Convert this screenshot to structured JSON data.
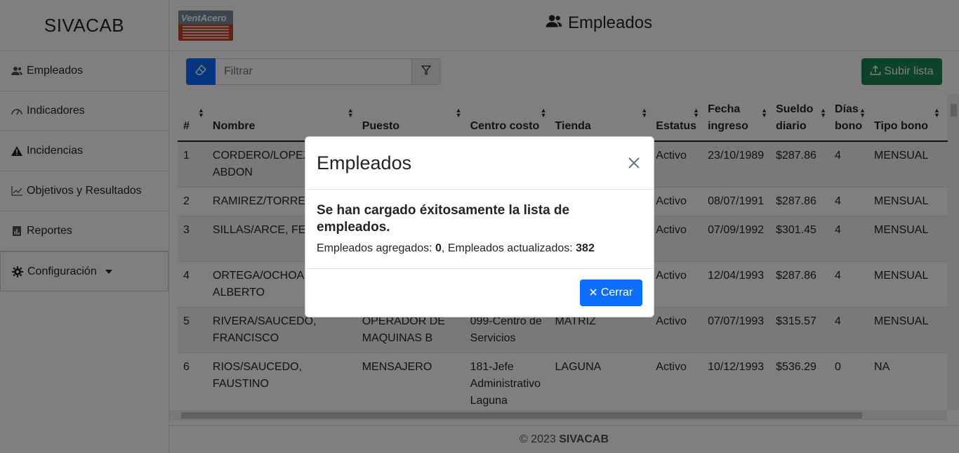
{
  "brand": "SIVACAB",
  "logo_text": "VentAcero",
  "sidebar": {
    "items": [
      {
        "label": "Empleados",
        "icon": "users-icon"
      },
      {
        "label": "Indicadores",
        "icon": "gauge-icon"
      },
      {
        "label": "Incidencias",
        "icon": "warning-icon"
      },
      {
        "label": "Objetivos y Resultados",
        "icon": "line-chart-icon"
      },
      {
        "label": "Reportes",
        "icon": "report-icon"
      },
      {
        "label": "Configuración",
        "icon": "gear-icon"
      }
    ]
  },
  "header": {
    "title": "Empleados"
  },
  "toolbar": {
    "filter_placeholder": "Filtrar",
    "upload_label": "Subir lista"
  },
  "table": {
    "columns": [
      "#",
      "Nombre",
      "Puesto",
      "Centro costo",
      "Tienda",
      "Estatus",
      "Fecha ingreso",
      "Sueldo diario",
      "Días bono",
      "Tipo bono"
    ],
    "rows": [
      {
        "n": "1",
        "nombre": "CORDERO/LOPEZ, ABDON",
        "puesto": "",
        "centro": "",
        "tienda": "",
        "estatus": "Activo",
        "fecha": "23/10/1989",
        "sueldo": "$287.86",
        "dias": "4",
        "tipo": "MENSUAL"
      },
      {
        "n": "2",
        "nombre": "RAMIREZ/TORRES,",
        "puesto": "",
        "centro": "",
        "tienda": "",
        "estatus": "Activo",
        "fecha": "08/07/1991",
        "sueldo": "$287.86",
        "dias": "4",
        "tipo": "MENSUAL"
      },
      {
        "n": "3",
        "nombre": "SILLAS/ARCE, FEDE",
        "puesto": "",
        "centro": "",
        "tienda": "",
        "estatus": "Activo",
        "fecha": "07/09/1992",
        "sueldo": "$301.45",
        "dias": "4",
        "tipo": "MENSUAL"
      },
      {
        "n": "4",
        "nombre": "ORTEGA/OCHOA, ALBERTO",
        "puesto": "",
        "centro": "",
        "tienda": "",
        "estatus": "Activo",
        "fecha": "12/04/1993",
        "sueldo": "$287.86",
        "dias": "4",
        "tipo": "MENSUAL"
      },
      {
        "n": "5",
        "nombre": "RIVERA/SAUCEDO, FRANCISCO",
        "puesto": "OPERADOR DE MAQUINAS B",
        "centro": "099-Centro de Servicios",
        "tienda": "MATRIZ",
        "estatus": "Activo",
        "fecha": "07/07/1993",
        "sueldo": "$315.57",
        "dias": "4",
        "tipo": "MENSUAL"
      },
      {
        "n": "6",
        "nombre": "RIOS/SAUCEDO, FAUSTINO",
        "puesto": "MENSAJERO",
        "centro": "181-Jefe Administrativo Laguna",
        "tienda": "LAGUNA",
        "estatus": "Activo",
        "fecha": "10/12/1993",
        "sueldo": "$536.29",
        "dias": "0",
        "tipo": "NA"
      }
    ]
  },
  "footer": {
    "copyright": "© 2023",
    "brand": "SIVACAB"
  },
  "modal": {
    "title": "Empleados",
    "message": "Se han cargado éxitosamente la lista de empleados.",
    "added_label": "Empleados agregados:",
    "added_value": "0",
    "updated_label": ", Empleados actualizados:",
    "updated_value": "382",
    "close_label": "Cerrar"
  },
  "colors": {
    "primary": "#0d6efd",
    "success": "#198754"
  }
}
